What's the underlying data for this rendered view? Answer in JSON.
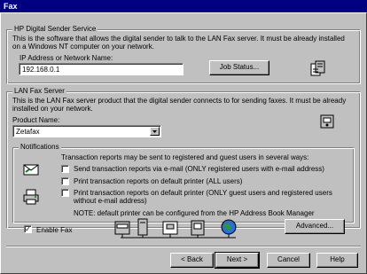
{
  "window": {
    "title": "Fax"
  },
  "digital_sender": {
    "legend": "HP Digital Sender Service",
    "description": "This is the software that allows the digital sender to talk to the LAN Fax server. It must be already installed on a Windows NT computer on your network.",
    "ip_label": "IP Address or Network Name:",
    "ip_value": "192.168.0.1",
    "job_status_button": "Job Status..."
  },
  "lan_fax": {
    "legend": "LAN Fax Server",
    "description": "This is the LAN Fax server product that the digital sender connects to for sending faxes. It must be already installed on your network.",
    "product_label": "Product Name:",
    "product_value": "Zetafax"
  },
  "notifications": {
    "legend": "Notifications",
    "intro": "Transaction reports may be sent to registered and guest users in several ways:",
    "options": [
      {
        "label": "Send transaction reports via e-mail (ONLY registered users with e-mail address)",
        "checked": false
      },
      {
        "label": "Print transaction reports on default printer (ALL users)",
        "checked": false
      },
      {
        "label": "Print transaction reports on default printer (ONLY guest users and registered users without e-mail address)",
        "checked": false
      }
    ],
    "note": "NOTE: default printer can be configured from the HP Address Book Manager"
  },
  "enable_fax": {
    "label": "Enable Fax",
    "checked": true
  },
  "buttons": {
    "advanced": "Advanced...",
    "back": "< Back",
    "next": "Next >",
    "cancel": "Cancel",
    "help": "Help"
  }
}
